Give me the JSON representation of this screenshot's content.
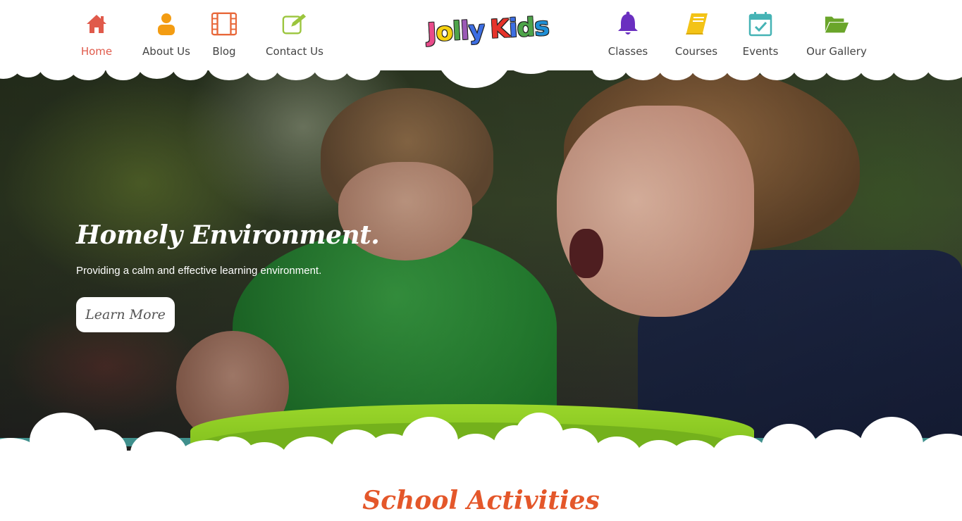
{
  "nav_left": [
    {
      "label": "Home",
      "icon": "home-icon",
      "color": "#e05a4b",
      "active": true
    },
    {
      "label": "About Us",
      "icon": "user-icon",
      "color": "#f39c12",
      "active": false
    },
    {
      "label": "Blog",
      "icon": "film-icon",
      "color": "#e8683a",
      "active": false
    },
    {
      "label": "Contact Us",
      "icon": "edit-icon",
      "color": "#9bc53d",
      "active": false
    }
  ],
  "nav_right": [
    {
      "label": "Classes",
      "icon": "bell-icon",
      "color": "#6a2fc0"
    },
    {
      "label": "Courses",
      "icon": "book-icon",
      "color": "#f3c316"
    },
    {
      "label": "Events",
      "icon": "calendar-icon",
      "color": "#45b3b5"
    },
    {
      "label": "Our Gallery",
      "icon": "folder-open-icon",
      "color": "#6aa52a"
    }
  ],
  "logo": {
    "letters": [
      "J",
      "o",
      "l",
      "l",
      "y",
      " ",
      "K",
      "i",
      "d",
      "s"
    ],
    "colors": [
      "#e94b8a",
      "#f6d10f",
      "#4ea44a",
      "#9b59b6",
      "#3d6ee3",
      "#ffffff",
      "#e6332a",
      "#3d6ee3",
      "#4ea44a",
      "#1f8fd6"
    ]
  },
  "hero": {
    "title": "Homely Environment.",
    "subtitle": "Providing a calm and effective learning environment.",
    "button": "Learn More"
  },
  "section": {
    "title": "School Activities"
  }
}
